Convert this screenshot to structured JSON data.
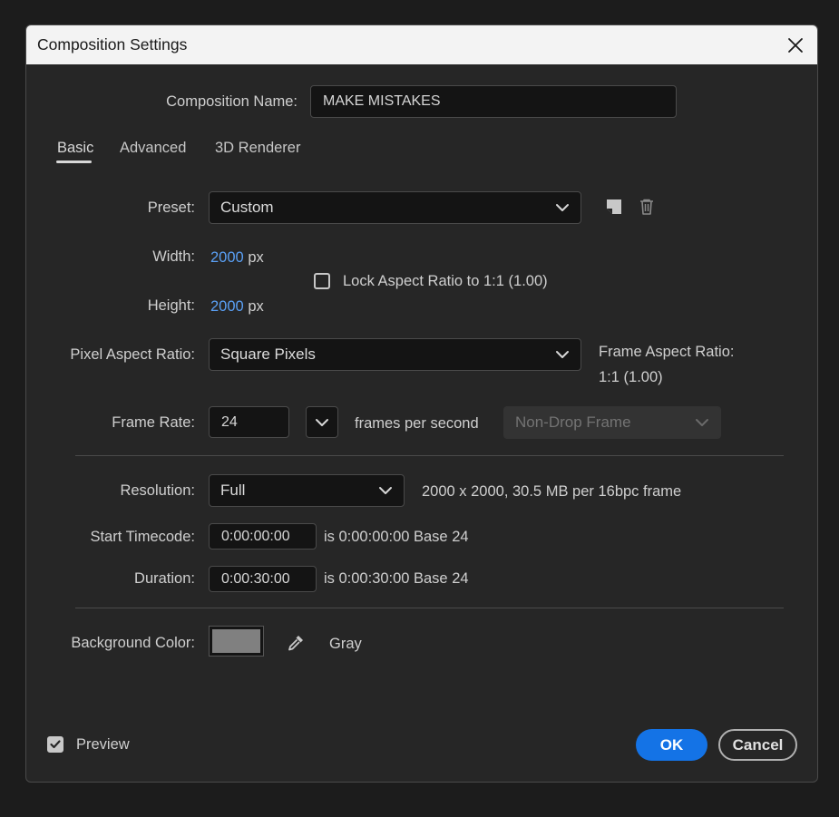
{
  "dialog": {
    "title": "Composition Settings"
  },
  "comp_name": {
    "label": "Composition Name:",
    "value": "MAKE MISTAKES"
  },
  "tabs": [
    {
      "label": "Basic",
      "active": true
    },
    {
      "label": "Advanced",
      "active": false
    },
    {
      "label": "3D Renderer",
      "active": false
    }
  ],
  "preset": {
    "label": "Preset:",
    "value": "Custom"
  },
  "width": {
    "label": "Width:",
    "value": "2000",
    "unit": "px"
  },
  "height": {
    "label": "Height:",
    "value": "2000",
    "unit": "px"
  },
  "lock_aspect": {
    "label": "Lock Aspect Ratio to 1:1 (1.00)",
    "checked": false
  },
  "pixel_aspect": {
    "label": "Pixel Aspect Ratio:",
    "value": "Square Pixels"
  },
  "frame_aspect": {
    "label": "Frame Aspect Ratio:",
    "value": "1:1 (1.00)"
  },
  "frame_rate": {
    "label": "Frame Rate:",
    "value": "24",
    "unit_label": "frames per second",
    "drop_frame": "Non-Drop Frame"
  },
  "resolution": {
    "label": "Resolution:",
    "value": "Full",
    "info": "2000 x 2000, 30.5 MB per 16bpc frame"
  },
  "start_timecode": {
    "label": "Start Timecode:",
    "value": "0:00:00:00",
    "is_text": "is 0:00:00:00",
    "base": "Base 24"
  },
  "duration": {
    "label": "Duration:",
    "value": "0:00:30:00",
    "is_text": "is 0:00:30:00",
    "base": "Base 24"
  },
  "background": {
    "label": "Background Color:",
    "color": "#808080",
    "name": "Gray"
  },
  "preview": {
    "label": "Preview",
    "checked": true
  },
  "buttons": {
    "ok": "OK",
    "cancel": "Cancel"
  },
  "colors": {
    "accent": "#1473e6",
    "link": "#5aa0f5"
  },
  "icons": {
    "close": "close-icon",
    "save_preset": "save-preset-icon",
    "delete_preset": "trash-icon",
    "eyedropper": "eyedropper-icon",
    "chevron": "chevron-down-icon",
    "check": "checkmark-icon"
  }
}
